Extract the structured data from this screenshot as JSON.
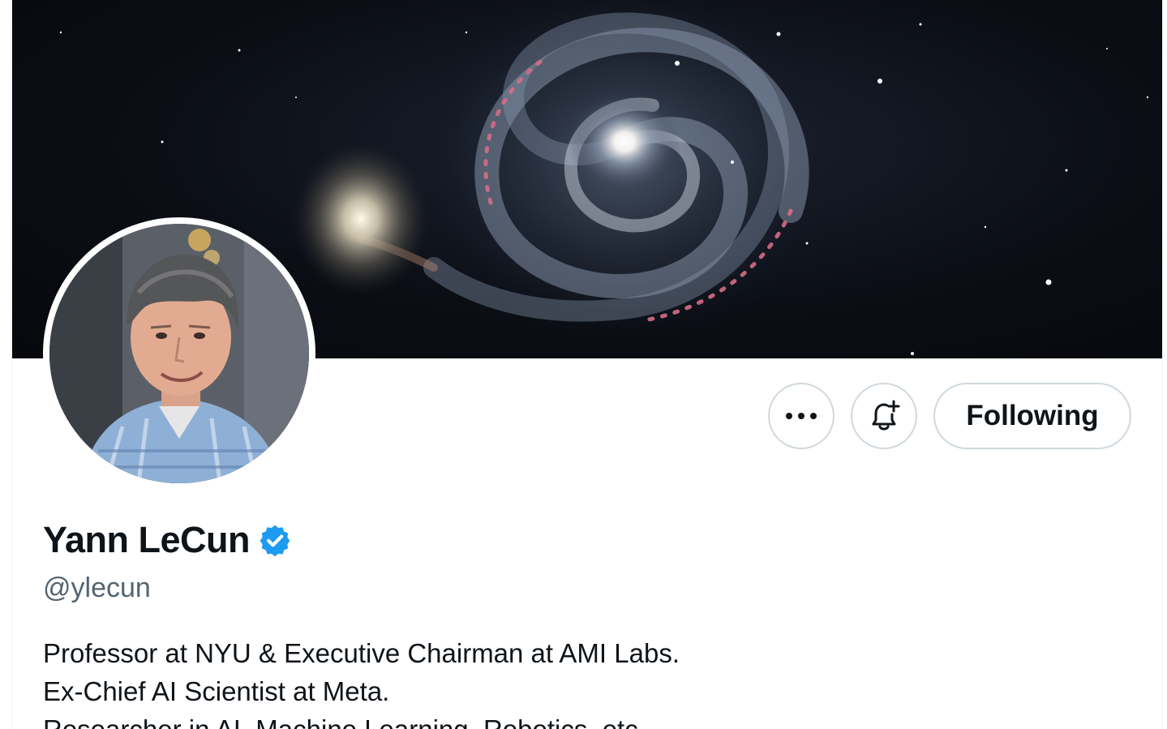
{
  "profile": {
    "display_name": "Yann LeCun",
    "handle": "@ylecun",
    "verified": true,
    "bio_lines": [
      "Professor at NYU & Executive Chairman at AMI Labs.",
      "Ex-Chief AI Scientist at Meta.",
      "Researcher in AI, Machine Learning, Robotics, etc."
    ]
  },
  "actions": {
    "more_icon": "more-horizontal-icon",
    "notify_icon": "bell-plus-icon",
    "follow_label": "Following"
  },
  "colors": {
    "text_primary": "#0f1419",
    "text_secondary": "#536471",
    "verified_blue": "#1d9bf0",
    "button_border": "#cfd9de"
  }
}
